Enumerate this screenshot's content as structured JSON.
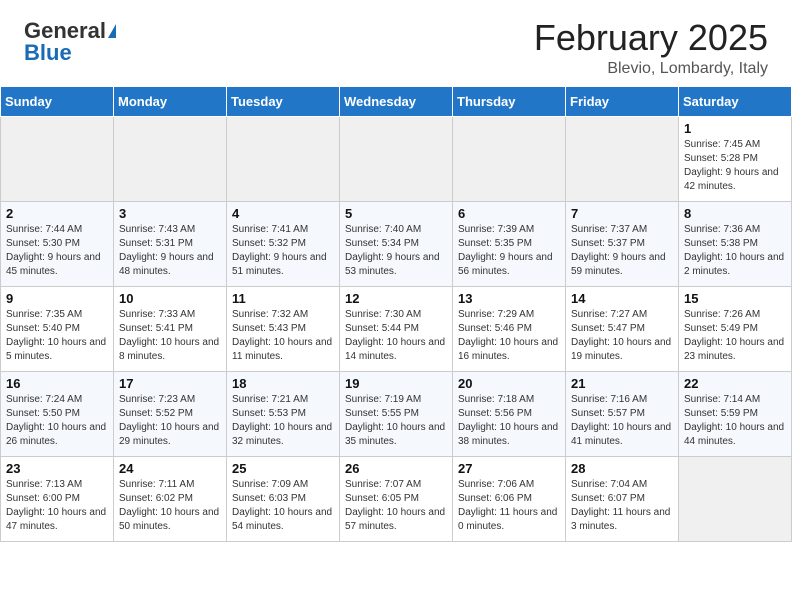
{
  "logo": {
    "general": "General",
    "blue": "Blue"
  },
  "header": {
    "month": "February 2025",
    "location": "Blevio, Lombardy, Italy"
  },
  "weekdays": [
    "Sunday",
    "Monday",
    "Tuesday",
    "Wednesday",
    "Thursday",
    "Friday",
    "Saturday"
  ],
  "weeks": [
    [
      {
        "day": "",
        "info": ""
      },
      {
        "day": "",
        "info": ""
      },
      {
        "day": "",
        "info": ""
      },
      {
        "day": "",
        "info": ""
      },
      {
        "day": "",
        "info": ""
      },
      {
        "day": "",
        "info": ""
      },
      {
        "day": "1",
        "info": "Sunrise: 7:45 AM\nSunset: 5:28 PM\nDaylight: 9 hours and 42 minutes."
      }
    ],
    [
      {
        "day": "2",
        "info": "Sunrise: 7:44 AM\nSunset: 5:30 PM\nDaylight: 9 hours and 45 minutes."
      },
      {
        "day": "3",
        "info": "Sunrise: 7:43 AM\nSunset: 5:31 PM\nDaylight: 9 hours and 48 minutes."
      },
      {
        "day": "4",
        "info": "Sunrise: 7:41 AM\nSunset: 5:32 PM\nDaylight: 9 hours and 51 minutes."
      },
      {
        "day": "5",
        "info": "Sunrise: 7:40 AM\nSunset: 5:34 PM\nDaylight: 9 hours and 53 minutes."
      },
      {
        "day": "6",
        "info": "Sunrise: 7:39 AM\nSunset: 5:35 PM\nDaylight: 9 hours and 56 minutes."
      },
      {
        "day": "7",
        "info": "Sunrise: 7:37 AM\nSunset: 5:37 PM\nDaylight: 9 hours and 59 minutes."
      },
      {
        "day": "8",
        "info": "Sunrise: 7:36 AM\nSunset: 5:38 PM\nDaylight: 10 hours and 2 minutes."
      }
    ],
    [
      {
        "day": "9",
        "info": "Sunrise: 7:35 AM\nSunset: 5:40 PM\nDaylight: 10 hours and 5 minutes."
      },
      {
        "day": "10",
        "info": "Sunrise: 7:33 AM\nSunset: 5:41 PM\nDaylight: 10 hours and 8 minutes."
      },
      {
        "day": "11",
        "info": "Sunrise: 7:32 AM\nSunset: 5:43 PM\nDaylight: 10 hours and 11 minutes."
      },
      {
        "day": "12",
        "info": "Sunrise: 7:30 AM\nSunset: 5:44 PM\nDaylight: 10 hours and 14 minutes."
      },
      {
        "day": "13",
        "info": "Sunrise: 7:29 AM\nSunset: 5:46 PM\nDaylight: 10 hours and 16 minutes."
      },
      {
        "day": "14",
        "info": "Sunrise: 7:27 AM\nSunset: 5:47 PM\nDaylight: 10 hours and 19 minutes."
      },
      {
        "day": "15",
        "info": "Sunrise: 7:26 AM\nSunset: 5:49 PM\nDaylight: 10 hours and 23 minutes."
      }
    ],
    [
      {
        "day": "16",
        "info": "Sunrise: 7:24 AM\nSunset: 5:50 PM\nDaylight: 10 hours and 26 minutes."
      },
      {
        "day": "17",
        "info": "Sunrise: 7:23 AM\nSunset: 5:52 PM\nDaylight: 10 hours and 29 minutes."
      },
      {
        "day": "18",
        "info": "Sunrise: 7:21 AM\nSunset: 5:53 PM\nDaylight: 10 hours and 32 minutes."
      },
      {
        "day": "19",
        "info": "Sunrise: 7:19 AM\nSunset: 5:55 PM\nDaylight: 10 hours and 35 minutes."
      },
      {
        "day": "20",
        "info": "Sunrise: 7:18 AM\nSunset: 5:56 PM\nDaylight: 10 hours and 38 minutes."
      },
      {
        "day": "21",
        "info": "Sunrise: 7:16 AM\nSunset: 5:57 PM\nDaylight: 10 hours and 41 minutes."
      },
      {
        "day": "22",
        "info": "Sunrise: 7:14 AM\nSunset: 5:59 PM\nDaylight: 10 hours and 44 minutes."
      }
    ],
    [
      {
        "day": "23",
        "info": "Sunrise: 7:13 AM\nSunset: 6:00 PM\nDaylight: 10 hours and 47 minutes."
      },
      {
        "day": "24",
        "info": "Sunrise: 7:11 AM\nSunset: 6:02 PM\nDaylight: 10 hours and 50 minutes."
      },
      {
        "day": "25",
        "info": "Sunrise: 7:09 AM\nSunset: 6:03 PM\nDaylight: 10 hours and 54 minutes."
      },
      {
        "day": "26",
        "info": "Sunrise: 7:07 AM\nSunset: 6:05 PM\nDaylight: 10 hours and 57 minutes."
      },
      {
        "day": "27",
        "info": "Sunrise: 7:06 AM\nSunset: 6:06 PM\nDaylight: 11 hours and 0 minutes."
      },
      {
        "day": "28",
        "info": "Sunrise: 7:04 AM\nSunset: 6:07 PM\nDaylight: 11 hours and 3 minutes."
      },
      {
        "day": "",
        "info": ""
      }
    ]
  ]
}
